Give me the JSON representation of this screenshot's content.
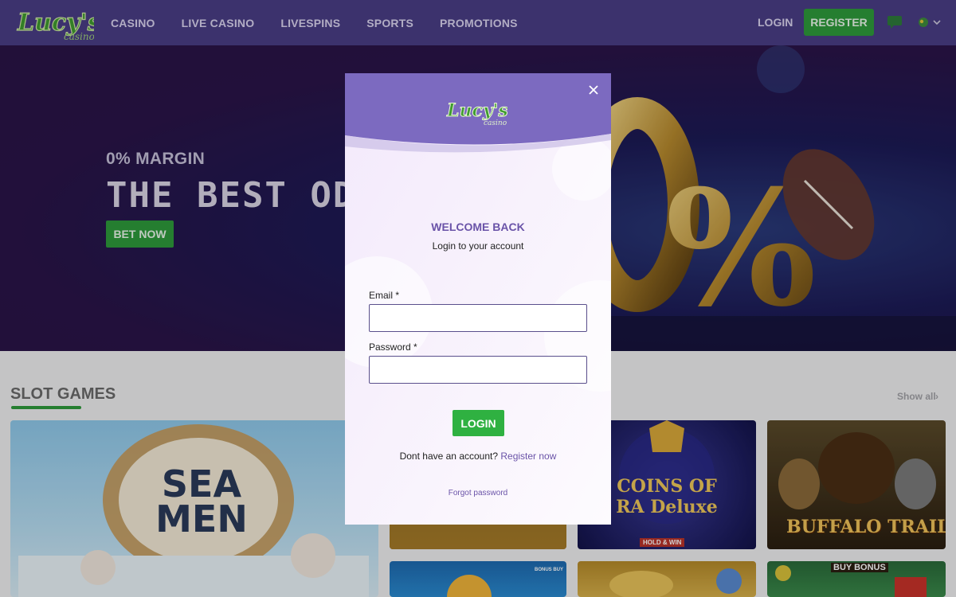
{
  "header": {
    "nav": [
      "CASINO",
      "LIVE CASINO",
      "LIVESPINS",
      "SPORTS",
      "PROMOTIONS"
    ],
    "login_label": "LOGIN",
    "register_label": "REGISTER",
    "icons": [
      "logo",
      "chat-icon",
      "flag-icon",
      "chevron-down-icon"
    ]
  },
  "hero": {
    "subtitle": "0% MARGIN",
    "title": "THE BEST ODDS",
    "button_label": "BET NOW"
  },
  "slots": {
    "title": "SLOT GAMES",
    "show_all": "Show all",
    "games": [
      "SEA MEN",
      "COINS OF RA Deluxe",
      "BUFFALO TRAIL"
    ],
    "badges": [
      "BONUS BUY",
      "BUY BONUS",
      "HOLD & WIN"
    ]
  },
  "modal": {
    "welcome": "WELCOME BACK",
    "subtitle": "Login to your account",
    "email_label": "Email *",
    "email_value": "",
    "password_label": "Password *",
    "password_value": "",
    "login_button": "LOGIN",
    "no_account": "Dont have an account?",
    "register_link": "Register now",
    "forgot": "Forgot password"
  },
  "colors": {
    "header_bg": "#4a3d86",
    "accent_green": "#2e9a3b",
    "modal_purple": "#7c6ac0",
    "link_purple": "#6a53a8"
  }
}
